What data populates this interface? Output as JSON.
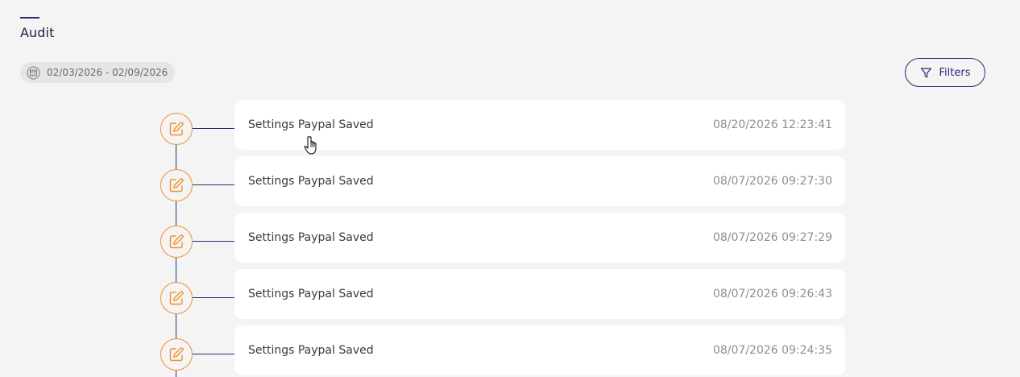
{
  "page": {
    "title": "Audit"
  },
  "date_range": {
    "label": "02/03/2026 - 02/09/2026",
    "icon": "calendar-icon"
  },
  "filters": {
    "label": "Filters",
    "icon": "filter-icon"
  },
  "colors": {
    "accent": "#2a2a7a",
    "node": "#f0912c",
    "background": "#f4f4f4",
    "card": "#ffffff"
  },
  "entries": [
    {
      "event": "Settings Paypal Saved",
      "timestamp": "08/20/2026 12:23:41",
      "icon": "edit-icon"
    },
    {
      "event": "Settings Paypal Saved",
      "timestamp": "08/07/2026 09:27:30",
      "icon": "edit-icon"
    },
    {
      "event": "Settings Paypal Saved",
      "timestamp": "08/07/2026 09:27:29",
      "icon": "edit-icon"
    },
    {
      "event": "Settings Paypal Saved",
      "timestamp": "08/07/2026 09:26:43",
      "icon": "edit-icon"
    },
    {
      "event": "Settings Paypal Saved",
      "timestamp": "08/07/2026 09:24:35",
      "icon": "edit-icon"
    }
  ]
}
